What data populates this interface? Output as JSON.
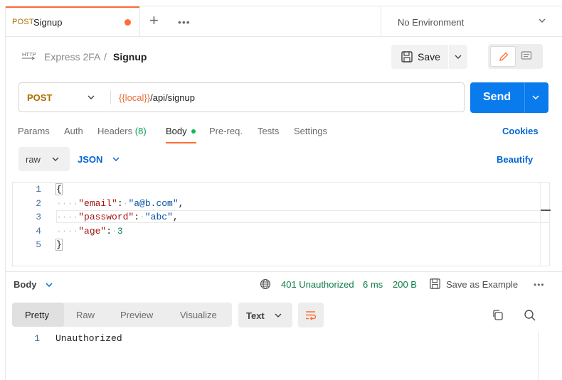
{
  "tab": {
    "method": "POST",
    "name": "Signup"
  },
  "environment": {
    "label": "No Environment"
  },
  "breadcrumb": {
    "parent": "Express 2FA",
    "separator": "/",
    "current": "Signup"
  },
  "toolbar": {
    "save_label": "Save"
  },
  "request": {
    "method": "POST",
    "url_variable": "{{local}}",
    "url_path": "/api/signup",
    "send_label": "Send"
  },
  "request_tabs": {
    "params": "Params",
    "auth": "Auth",
    "headers": "Headers",
    "headers_count": "(8)",
    "body": "Body",
    "prereq": "Pre-req.",
    "tests": "Tests",
    "settings": "Settings",
    "cookies": "Cookies"
  },
  "body_options": {
    "mode": "raw",
    "language": "JSON",
    "beautify": "Beautify"
  },
  "editor": {
    "line_numbers": [
      "1",
      "2",
      "3",
      "4",
      "5"
    ],
    "open_brace": "{",
    "close_brace": "}",
    "entries": [
      {
        "key": "\"email\"",
        "value": "\"a@b.com\"",
        "value_type": "string",
        "comma": ","
      },
      {
        "key": "\"password\"",
        "value": "\"abc\"",
        "value_type": "string",
        "comma": ","
      },
      {
        "key": "\"age\"",
        "value": "3",
        "value_type": "number",
        "comma": ""
      }
    ],
    "indent_dots": "····",
    "colon": ":"
  },
  "response": {
    "section_label": "Body",
    "status": "401 Unauthorized",
    "time": "6 ms",
    "size": "200 B",
    "save_example": "Save as Example",
    "view_tabs": [
      "Pretty",
      "Raw",
      "Preview",
      "Visualize"
    ],
    "active_view": "Pretty",
    "format": "Text",
    "line_number": "1",
    "content": "Unauthorized"
  },
  "colors": {
    "accent": "#ff6c37",
    "send": "#097bed",
    "link": "#0265d2",
    "status_ok": "#0f7d47",
    "method": "#b06d00"
  },
  "icons": [
    "more-icon",
    "plus-icon",
    "chevron-down-icon",
    "http-icon",
    "save-icon",
    "pencil-icon",
    "comment-icon",
    "globe-icon",
    "wrap-icon",
    "copy-icon",
    "search-icon"
  ]
}
